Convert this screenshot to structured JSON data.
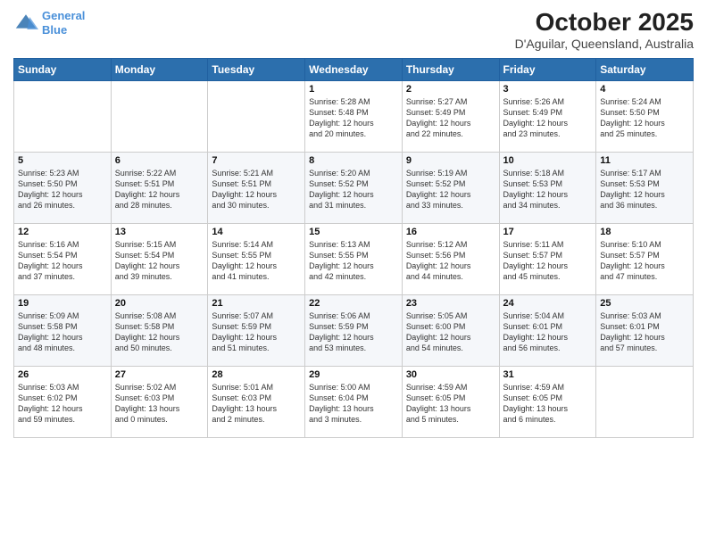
{
  "logo": {
    "line1": "General",
    "line2": "Blue"
  },
  "title": "October 2025",
  "subtitle": "D'Aguilar, Queensland, Australia",
  "days_of_week": [
    "Sunday",
    "Monday",
    "Tuesday",
    "Wednesday",
    "Thursday",
    "Friday",
    "Saturday"
  ],
  "weeks": [
    [
      {
        "day": "",
        "info": ""
      },
      {
        "day": "",
        "info": ""
      },
      {
        "day": "",
        "info": ""
      },
      {
        "day": "1",
        "info": "Sunrise: 5:28 AM\nSunset: 5:48 PM\nDaylight: 12 hours\nand 20 minutes."
      },
      {
        "day": "2",
        "info": "Sunrise: 5:27 AM\nSunset: 5:49 PM\nDaylight: 12 hours\nand 22 minutes."
      },
      {
        "day": "3",
        "info": "Sunrise: 5:26 AM\nSunset: 5:49 PM\nDaylight: 12 hours\nand 23 minutes."
      },
      {
        "day": "4",
        "info": "Sunrise: 5:24 AM\nSunset: 5:50 PM\nDaylight: 12 hours\nand 25 minutes."
      }
    ],
    [
      {
        "day": "5",
        "info": "Sunrise: 5:23 AM\nSunset: 5:50 PM\nDaylight: 12 hours\nand 26 minutes."
      },
      {
        "day": "6",
        "info": "Sunrise: 5:22 AM\nSunset: 5:51 PM\nDaylight: 12 hours\nand 28 minutes."
      },
      {
        "day": "7",
        "info": "Sunrise: 5:21 AM\nSunset: 5:51 PM\nDaylight: 12 hours\nand 30 minutes."
      },
      {
        "day": "8",
        "info": "Sunrise: 5:20 AM\nSunset: 5:52 PM\nDaylight: 12 hours\nand 31 minutes."
      },
      {
        "day": "9",
        "info": "Sunrise: 5:19 AM\nSunset: 5:52 PM\nDaylight: 12 hours\nand 33 minutes."
      },
      {
        "day": "10",
        "info": "Sunrise: 5:18 AM\nSunset: 5:53 PM\nDaylight: 12 hours\nand 34 minutes."
      },
      {
        "day": "11",
        "info": "Sunrise: 5:17 AM\nSunset: 5:53 PM\nDaylight: 12 hours\nand 36 minutes."
      }
    ],
    [
      {
        "day": "12",
        "info": "Sunrise: 5:16 AM\nSunset: 5:54 PM\nDaylight: 12 hours\nand 37 minutes."
      },
      {
        "day": "13",
        "info": "Sunrise: 5:15 AM\nSunset: 5:54 PM\nDaylight: 12 hours\nand 39 minutes."
      },
      {
        "day": "14",
        "info": "Sunrise: 5:14 AM\nSunset: 5:55 PM\nDaylight: 12 hours\nand 41 minutes."
      },
      {
        "day": "15",
        "info": "Sunrise: 5:13 AM\nSunset: 5:55 PM\nDaylight: 12 hours\nand 42 minutes."
      },
      {
        "day": "16",
        "info": "Sunrise: 5:12 AM\nSunset: 5:56 PM\nDaylight: 12 hours\nand 44 minutes."
      },
      {
        "day": "17",
        "info": "Sunrise: 5:11 AM\nSunset: 5:57 PM\nDaylight: 12 hours\nand 45 minutes."
      },
      {
        "day": "18",
        "info": "Sunrise: 5:10 AM\nSunset: 5:57 PM\nDaylight: 12 hours\nand 47 minutes."
      }
    ],
    [
      {
        "day": "19",
        "info": "Sunrise: 5:09 AM\nSunset: 5:58 PM\nDaylight: 12 hours\nand 48 minutes."
      },
      {
        "day": "20",
        "info": "Sunrise: 5:08 AM\nSunset: 5:58 PM\nDaylight: 12 hours\nand 50 minutes."
      },
      {
        "day": "21",
        "info": "Sunrise: 5:07 AM\nSunset: 5:59 PM\nDaylight: 12 hours\nand 51 minutes."
      },
      {
        "day": "22",
        "info": "Sunrise: 5:06 AM\nSunset: 5:59 PM\nDaylight: 12 hours\nand 53 minutes."
      },
      {
        "day": "23",
        "info": "Sunrise: 5:05 AM\nSunset: 6:00 PM\nDaylight: 12 hours\nand 54 minutes."
      },
      {
        "day": "24",
        "info": "Sunrise: 5:04 AM\nSunset: 6:01 PM\nDaylight: 12 hours\nand 56 minutes."
      },
      {
        "day": "25",
        "info": "Sunrise: 5:03 AM\nSunset: 6:01 PM\nDaylight: 12 hours\nand 57 minutes."
      }
    ],
    [
      {
        "day": "26",
        "info": "Sunrise: 5:03 AM\nSunset: 6:02 PM\nDaylight: 12 hours\nand 59 minutes."
      },
      {
        "day": "27",
        "info": "Sunrise: 5:02 AM\nSunset: 6:03 PM\nDaylight: 13 hours\nand 0 minutes."
      },
      {
        "day": "28",
        "info": "Sunrise: 5:01 AM\nSunset: 6:03 PM\nDaylight: 13 hours\nand 2 minutes."
      },
      {
        "day": "29",
        "info": "Sunrise: 5:00 AM\nSunset: 6:04 PM\nDaylight: 13 hours\nand 3 minutes."
      },
      {
        "day": "30",
        "info": "Sunrise: 4:59 AM\nSunset: 6:05 PM\nDaylight: 13 hours\nand 5 minutes."
      },
      {
        "day": "31",
        "info": "Sunrise: 4:59 AM\nSunset: 6:05 PM\nDaylight: 13 hours\nand 6 minutes."
      },
      {
        "day": "",
        "info": ""
      }
    ]
  ]
}
